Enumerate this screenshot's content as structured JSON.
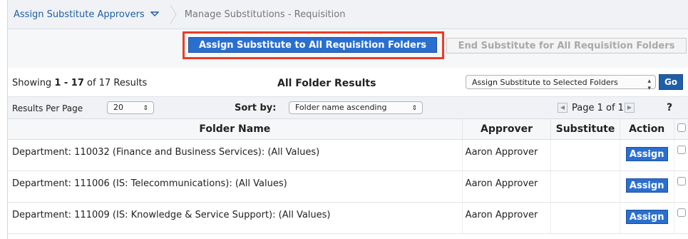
{
  "breadcrumb": {
    "root_label": "Assign Substitute Approvers",
    "current_label": "Manage Substitutions - Requisition"
  },
  "actions": {
    "assign_all_label": "Assign Substitute to All Requisition Folders",
    "end_all_label": "End Substitute for All Requisition Folders"
  },
  "results": {
    "showing_prefix": "Showing ",
    "range": "1 - 17",
    "of_text": " of 17 Results",
    "section_title": "All Folder Results",
    "bulk_select_value": "Assign Substitute to Selected Folders",
    "go_label": "Go"
  },
  "toolbar": {
    "results_per_page_label": "Results Per Page",
    "results_per_page_value": "20",
    "sort_by_label": "Sort by:",
    "sort_value": "Folder name ascending",
    "page_text": "Page 1 of 1",
    "help_label": "?"
  },
  "table": {
    "headers": {
      "folder_name": "Folder Name",
      "approver": "Approver",
      "substitute": "Substitute",
      "action": "Action"
    },
    "rows": [
      {
        "folder": "Department: 110032 (Finance and Business Services): (All Values)",
        "approver": "Aaron Approver",
        "substitute": "",
        "action": "Assign"
      },
      {
        "folder": "Department: 111006 (IS: Telecommunications): (All Values)",
        "approver": "Aaron Approver",
        "substitute": "",
        "action": "Assign"
      },
      {
        "folder": "Department: 111009 (IS: Knowledge & Service Support): (All Values)",
        "approver": "Aaron Approver",
        "substitute": "",
        "action": "Assign"
      }
    ]
  },
  "colors": {
    "accent": "#2a6fd0",
    "highlight": "#ec3c23",
    "link": "#1f5fa8"
  }
}
